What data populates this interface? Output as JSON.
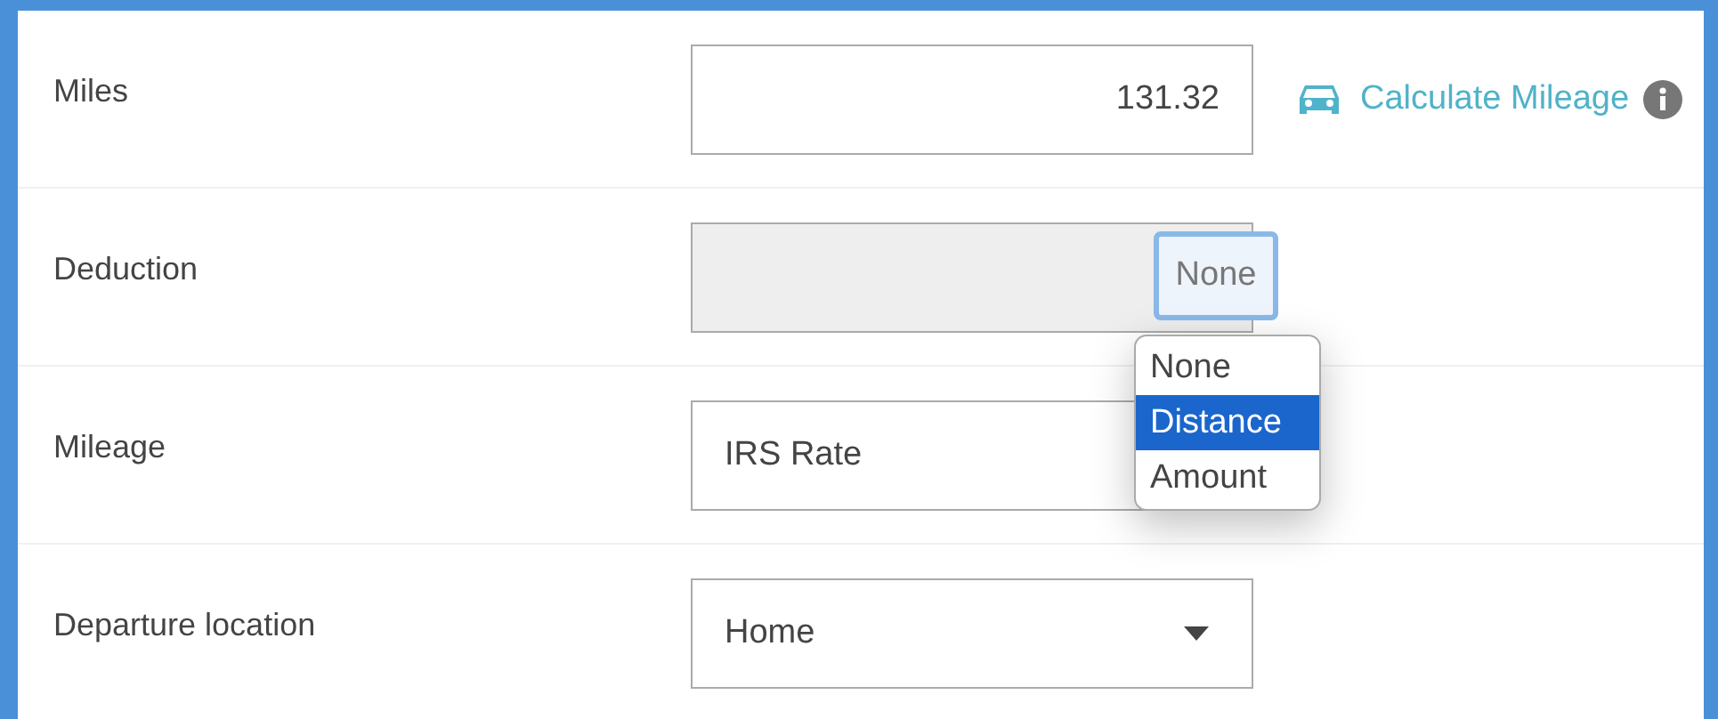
{
  "rows": [
    {
      "kind": "input",
      "label": "Miles",
      "value": "131.32",
      "link": "Calculate Mileage"
    },
    {
      "kind": "toggle",
      "label": "Deduction",
      "button": "None",
      "menu": [
        {
          "label": "None",
          "selected": false
        },
        {
          "label": "Distance",
          "selected": true
        },
        {
          "label": "Amount",
          "selected": false
        }
      ]
    },
    {
      "kind": "box",
      "label": "Mileage",
      "value": "IRS Rate"
    },
    {
      "kind": "select",
      "label": "Departure location",
      "value": "Home"
    }
  ]
}
